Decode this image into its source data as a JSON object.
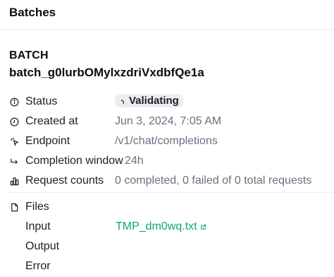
{
  "header": {
    "title": "Batches"
  },
  "batch": {
    "label": "BATCH",
    "id": "batch_g0lurbOMylxzdriVxdbfQe1a"
  },
  "details": {
    "status": {
      "label": "Status",
      "value": "Validating"
    },
    "created_at": {
      "label": "Created at",
      "value": "Jun 3, 2024, 7:05 AM"
    },
    "endpoint": {
      "label": "Endpoint",
      "value": "/v1/chat/completions"
    },
    "completion_window": {
      "label": "Completion window",
      "value": "24h"
    },
    "request_counts": {
      "label": "Request counts",
      "value": "0 completed, 0 failed of 0 total requests"
    }
  },
  "files": {
    "label": "Files",
    "input": {
      "label": "Input",
      "value": "TMP_dm0wq.txt"
    },
    "output": {
      "label": "Output"
    },
    "error": {
      "label": "Error"
    }
  },
  "colors": {
    "link": "#10a37f",
    "badge_bg": "#ececf1",
    "muted_text": "#6e6e80"
  },
  "icons": {
    "status": "info-icon",
    "created_at": "clock-icon",
    "endpoint": "pointer-icon",
    "completion_window": "arrow-return-icon",
    "request_counts": "bar-chart-icon",
    "files": "file-icon",
    "external": "external-link-icon",
    "spinner": "spinner-icon"
  }
}
